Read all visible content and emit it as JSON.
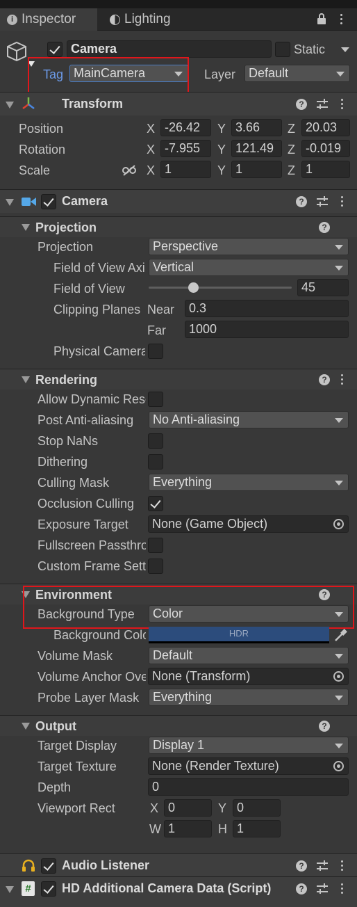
{
  "tabs": {
    "inspector": "Inspector",
    "lighting": "Lighting"
  },
  "object": {
    "enabled": true,
    "name": "Camera",
    "static_label": "Static",
    "tag_label": "Tag",
    "tag_value": "MainCamera",
    "layer_label": "Layer",
    "layer_value": "Default"
  },
  "transform": {
    "title": "Transform",
    "position_label": "Position",
    "rotation_label": "Rotation",
    "scale_label": "Scale",
    "axis_x": "X",
    "axis_y": "Y",
    "axis_z": "Z",
    "position": {
      "x": "-26.42",
      "y": "3.66",
      "z": "20.03"
    },
    "rotation": {
      "x": "-7.955",
      "y": "121.49",
      "z": "-0.019"
    },
    "scale": {
      "x": "1",
      "y": "1",
      "z": "1"
    }
  },
  "camera": {
    "title": "Camera",
    "projection": {
      "header": "Projection",
      "projection_label": "Projection",
      "projection_value": "Perspective",
      "fov_axis_label": "Field of View Axis",
      "fov_axis_value": "Vertical",
      "fov_label": "Field of View",
      "fov_value": "45",
      "fov_slider_fraction": 0.31,
      "clipping_label": "Clipping Planes",
      "near_label": "Near",
      "near_value": "0.3",
      "far_label": "Far",
      "far_value": "1000",
      "physical_label": "Physical Camera"
    },
    "rendering": {
      "header": "Rendering",
      "allow_dynamic_label": "Allow Dynamic Resolution",
      "post_aa_label": "Post Anti-aliasing",
      "post_aa_value": "No Anti-aliasing",
      "stop_nans_label": "Stop NaNs",
      "dithering_label": "Dithering",
      "culling_mask_label": "Culling Mask",
      "culling_mask_value": "Everything",
      "occlusion_label": "Occlusion Culling",
      "exposure_label": "Exposure Target",
      "exposure_value": "None (Game Object)",
      "fullscreen_label": "Fullscreen Passthrough",
      "custom_frame_label": "Custom Frame Settings"
    },
    "environment": {
      "header": "Environment",
      "bg_type_label": "Background Type",
      "bg_type_value": "Color",
      "bg_color_label": "Background Color",
      "bg_color_hdr": "HDR",
      "bg_color": "#2c4c7c",
      "volume_mask_label": "Volume Mask",
      "volume_mask_value": "Default",
      "volume_anchor_label": "Volume Anchor Override",
      "volume_anchor_value": "None (Transform)",
      "probe_mask_label": "Probe Layer Mask",
      "probe_mask_value": "Everything"
    },
    "output": {
      "header": "Output",
      "target_display_label": "Target Display",
      "target_display_value": "Display 1",
      "target_texture_label": "Target Texture",
      "target_texture_value": "None (Render Texture)",
      "depth_label": "Depth",
      "depth_value": "0",
      "viewport_label": "Viewport Rect",
      "x_label": "X",
      "x_value": "0",
      "y_label": "Y",
      "y_value": "0",
      "w_label": "W",
      "w_value": "1",
      "h_label": "H",
      "h_value": "1"
    }
  },
  "audio_listener": {
    "title": "Audio Listener"
  },
  "hd_camera_data": {
    "title": "HD Additional Camera Data (Script)"
  },
  "colors": {
    "highlight": "#e0161b",
    "panel": "#383838",
    "header": "#3e3e3e"
  }
}
